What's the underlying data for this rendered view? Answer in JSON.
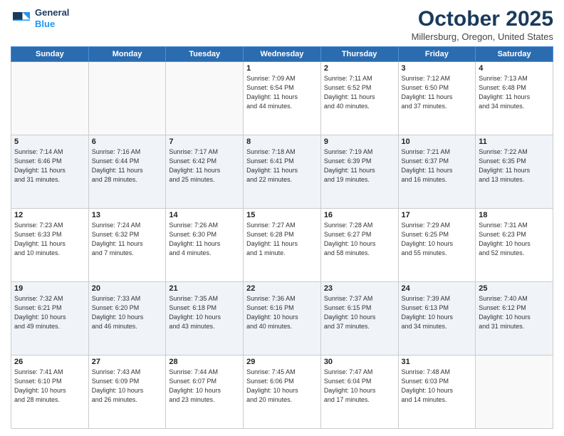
{
  "header": {
    "logo_line1": "General",
    "logo_line2": "Blue",
    "month_title": "October 2025",
    "location": "Millersburg, Oregon, United States"
  },
  "days_of_week": [
    "Sunday",
    "Monday",
    "Tuesday",
    "Wednesday",
    "Thursday",
    "Friday",
    "Saturday"
  ],
  "weeks": [
    [
      {
        "day": "",
        "info": ""
      },
      {
        "day": "",
        "info": ""
      },
      {
        "day": "",
        "info": ""
      },
      {
        "day": "1",
        "info": "Sunrise: 7:09 AM\nSunset: 6:54 PM\nDaylight: 11 hours\nand 44 minutes."
      },
      {
        "day": "2",
        "info": "Sunrise: 7:11 AM\nSunset: 6:52 PM\nDaylight: 11 hours\nand 40 minutes."
      },
      {
        "day": "3",
        "info": "Sunrise: 7:12 AM\nSunset: 6:50 PM\nDaylight: 11 hours\nand 37 minutes."
      },
      {
        "day": "4",
        "info": "Sunrise: 7:13 AM\nSunset: 6:48 PM\nDaylight: 11 hours\nand 34 minutes."
      }
    ],
    [
      {
        "day": "5",
        "info": "Sunrise: 7:14 AM\nSunset: 6:46 PM\nDaylight: 11 hours\nand 31 minutes."
      },
      {
        "day": "6",
        "info": "Sunrise: 7:16 AM\nSunset: 6:44 PM\nDaylight: 11 hours\nand 28 minutes."
      },
      {
        "day": "7",
        "info": "Sunrise: 7:17 AM\nSunset: 6:42 PM\nDaylight: 11 hours\nand 25 minutes."
      },
      {
        "day": "8",
        "info": "Sunrise: 7:18 AM\nSunset: 6:41 PM\nDaylight: 11 hours\nand 22 minutes."
      },
      {
        "day": "9",
        "info": "Sunrise: 7:19 AM\nSunset: 6:39 PM\nDaylight: 11 hours\nand 19 minutes."
      },
      {
        "day": "10",
        "info": "Sunrise: 7:21 AM\nSunset: 6:37 PM\nDaylight: 11 hours\nand 16 minutes."
      },
      {
        "day": "11",
        "info": "Sunrise: 7:22 AM\nSunset: 6:35 PM\nDaylight: 11 hours\nand 13 minutes."
      }
    ],
    [
      {
        "day": "12",
        "info": "Sunrise: 7:23 AM\nSunset: 6:33 PM\nDaylight: 11 hours\nand 10 minutes."
      },
      {
        "day": "13",
        "info": "Sunrise: 7:24 AM\nSunset: 6:32 PM\nDaylight: 11 hours\nand 7 minutes."
      },
      {
        "day": "14",
        "info": "Sunrise: 7:26 AM\nSunset: 6:30 PM\nDaylight: 11 hours\nand 4 minutes."
      },
      {
        "day": "15",
        "info": "Sunrise: 7:27 AM\nSunset: 6:28 PM\nDaylight: 11 hours\nand 1 minute."
      },
      {
        "day": "16",
        "info": "Sunrise: 7:28 AM\nSunset: 6:27 PM\nDaylight: 10 hours\nand 58 minutes."
      },
      {
        "day": "17",
        "info": "Sunrise: 7:29 AM\nSunset: 6:25 PM\nDaylight: 10 hours\nand 55 minutes."
      },
      {
        "day": "18",
        "info": "Sunrise: 7:31 AM\nSunset: 6:23 PM\nDaylight: 10 hours\nand 52 minutes."
      }
    ],
    [
      {
        "day": "19",
        "info": "Sunrise: 7:32 AM\nSunset: 6:21 PM\nDaylight: 10 hours\nand 49 minutes."
      },
      {
        "day": "20",
        "info": "Sunrise: 7:33 AM\nSunset: 6:20 PM\nDaylight: 10 hours\nand 46 minutes."
      },
      {
        "day": "21",
        "info": "Sunrise: 7:35 AM\nSunset: 6:18 PM\nDaylight: 10 hours\nand 43 minutes."
      },
      {
        "day": "22",
        "info": "Sunrise: 7:36 AM\nSunset: 6:16 PM\nDaylight: 10 hours\nand 40 minutes."
      },
      {
        "day": "23",
        "info": "Sunrise: 7:37 AM\nSunset: 6:15 PM\nDaylight: 10 hours\nand 37 minutes."
      },
      {
        "day": "24",
        "info": "Sunrise: 7:39 AM\nSunset: 6:13 PM\nDaylight: 10 hours\nand 34 minutes."
      },
      {
        "day": "25",
        "info": "Sunrise: 7:40 AM\nSunset: 6:12 PM\nDaylight: 10 hours\nand 31 minutes."
      }
    ],
    [
      {
        "day": "26",
        "info": "Sunrise: 7:41 AM\nSunset: 6:10 PM\nDaylight: 10 hours\nand 28 minutes."
      },
      {
        "day": "27",
        "info": "Sunrise: 7:43 AM\nSunset: 6:09 PM\nDaylight: 10 hours\nand 26 minutes."
      },
      {
        "day": "28",
        "info": "Sunrise: 7:44 AM\nSunset: 6:07 PM\nDaylight: 10 hours\nand 23 minutes."
      },
      {
        "day": "29",
        "info": "Sunrise: 7:45 AM\nSunset: 6:06 PM\nDaylight: 10 hours\nand 20 minutes."
      },
      {
        "day": "30",
        "info": "Sunrise: 7:47 AM\nSunset: 6:04 PM\nDaylight: 10 hours\nand 17 minutes."
      },
      {
        "day": "31",
        "info": "Sunrise: 7:48 AM\nSunset: 6:03 PM\nDaylight: 10 hours\nand 14 minutes."
      },
      {
        "day": "",
        "info": ""
      }
    ]
  ]
}
